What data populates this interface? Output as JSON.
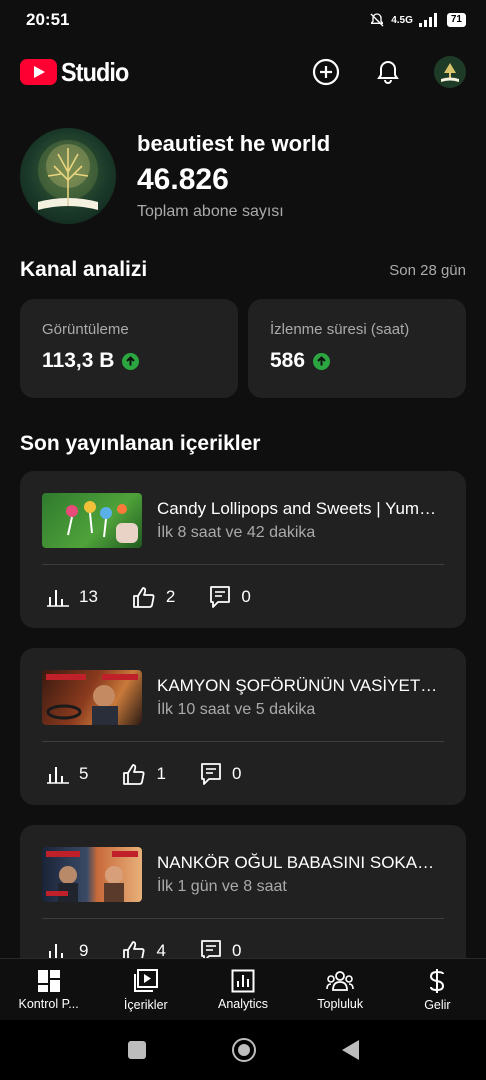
{
  "status_bar": {
    "time": "20:51",
    "network": "4.5G",
    "battery": "71"
  },
  "app": {
    "logo_text": "Studio",
    "brand_color": "#ff0033"
  },
  "channel": {
    "name": "beautiest he world",
    "subscriber_count": "46.826",
    "subscriber_label": "Toplam abone sayısı"
  },
  "analytics": {
    "title": "Kanal analizi",
    "period": "Son 28 gün",
    "cards": [
      {
        "label": "Görüntüleme",
        "value": "113,3 B"
      },
      {
        "label": "İzlenme süresi (saat)",
        "value": "586"
      }
    ],
    "trend_color": "#2ba640"
  },
  "recent": {
    "title": "Son yayınlanan içerikler",
    "items": [
      {
        "title": "Candy Lollipops and Sweets | Yummy Candy",
        "subtitle": "İlk 8 saat ve 42 dakika",
        "views": "13",
        "likes": "2",
        "comments": "0"
      },
      {
        "title": "KAMYON ŞOFÖRÜNÜN VASİYETİ VE OĞLU",
        "subtitle": "İlk 10 saat ve 5 dakika",
        "views": "5",
        "likes": "1",
        "comments": "0"
      },
      {
        "title": "NANKÖR OĞUL BABASINI SOKAĞA ATTI",
        "subtitle": "İlk 1 gün ve 8 saat",
        "views": "9",
        "likes": "4",
        "comments": "0"
      }
    ]
  },
  "bottom_nav": [
    {
      "label": "Kontrol P...",
      "icon": "dashboard-icon"
    },
    {
      "label": "İçerikler",
      "icon": "content-icon"
    },
    {
      "label": "Analytics",
      "icon": "analytics-icon"
    },
    {
      "label": "Topluluk",
      "icon": "community-icon"
    },
    {
      "label": "Gelir",
      "icon": "dollar-icon"
    }
  ]
}
